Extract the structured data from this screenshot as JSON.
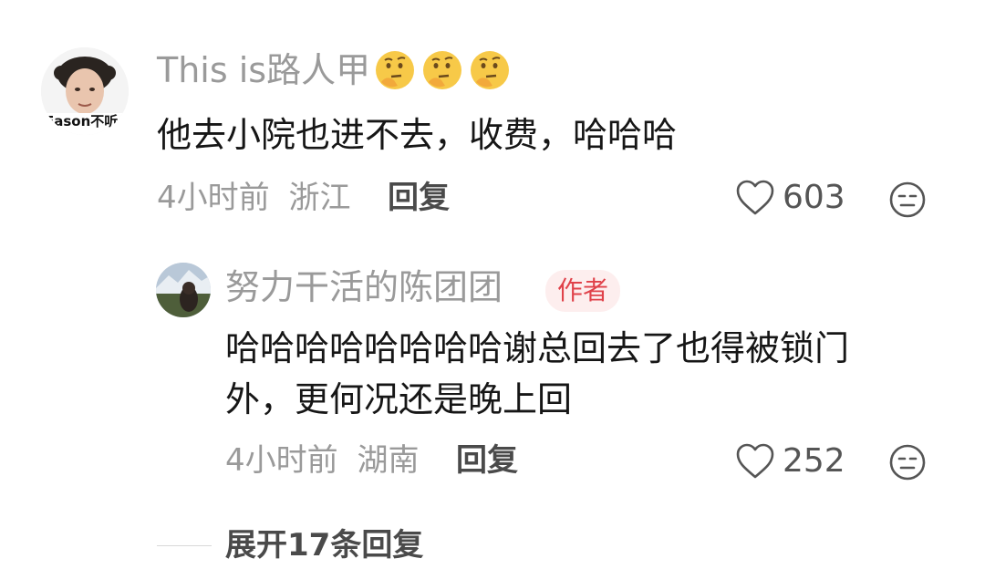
{
  "comment": {
    "avatar_caption": "Eason不听",
    "username": "This is路人甲",
    "username_emojis": [
      "thinking-face-emoji",
      "thinking-face-emoji",
      "thinking-face-emoji"
    ],
    "text": "他去小院也进不去，收费，哈哈哈",
    "time": "4小时前",
    "location": "浙江",
    "reply_label": "回复",
    "like_count": "603"
  },
  "reply": {
    "username": "努力干活的陈团团",
    "badge": "作者",
    "text_line1": "哈哈哈哈哈哈哈哈谢总回去了也得被锁门",
    "text_line2": "外，更何况还是晚上回",
    "time": "4小时前",
    "location": "湖南",
    "reply_label": "回复",
    "like_count": "252"
  },
  "expand": {
    "label": "展开17条回复"
  },
  "colors": {
    "muted": "#9a9a9a",
    "text": "#161616",
    "badge_bg": "#fdeeee",
    "badge_text": "#e0424a"
  }
}
